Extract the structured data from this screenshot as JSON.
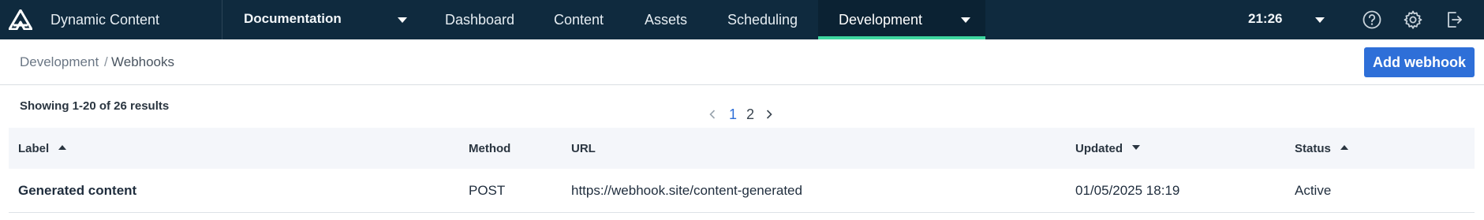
{
  "topbar": {
    "app_name": "Dynamic Content",
    "hub": "Documentation",
    "tabs": [
      {
        "label": "Dashboard"
      },
      {
        "label": "Content"
      },
      {
        "label": "Assets"
      },
      {
        "label": "Scheduling"
      },
      {
        "label": "Development",
        "active": true
      }
    ],
    "clock": "21:26",
    "icons": [
      "amplience-logo-icon",
      "help-icon",
      "settings-gear-icon",
      "logout-icon"
    ],
    "active_tab_indicator_color": "#3ed6a0"
  },
  "breadcrumb": {
    "root": "Development",
    "separator": "/",
    "current": "Webhooks"
  },
  "add_button": {
    "label": "Add webhook",
    "color": "#2e6fd8"
  },
  "list": {
    "summary": "Showing 1-20 of 26 results",
    "pagination": {
      "pages": [
        "1",
        "2"
      ],
      "current": "1"
    },
    "columns": [
      {
        "label": "Label",
        "sort": "asc"
      },
      {
        "label": "Method"
      },
      {
        "label": "URL"
      },
      {
        "label": "Updated",
        "sort": "desc"
      },
      {
        "label": "Status",
        "sort": "asc"
      }
    ],
    "rows": [
      {
        "label": "Generated content",
        "method": "POST",
        "url": "https://webhook.site/content-generated",
        "updated": "01/05/2025 18:19",
        "status": "Active"
      }
    ]
  }
}
